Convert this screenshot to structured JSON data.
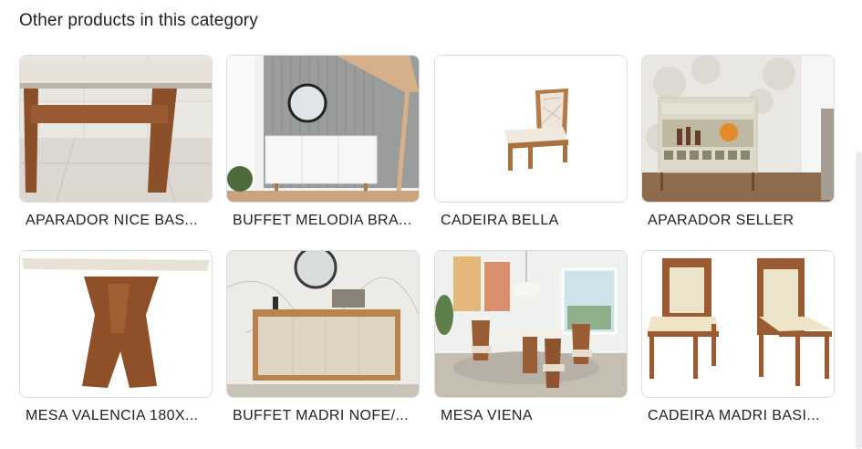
{
  "section": {
    "title": "Other products in this category"
  },
  "products": [
    {
      "name": "APARADOR NICE BAS...",
      "image": "sideboard-table-image"
    },
    {
      "name": "BUFFET MELODIA BRA...",
      "image": "buffet-room-image"
    },
    {
      "name": "CADEIRA BELLA",
      "image": "chair-image"
    },
    {
      "name": "APARADOR SELLER",
      "image": "bar-cabinet-image"
    },
    {
      "name": "MESA VALENCIA 180X...",
      "image": "dining-table-image"
    },
    {
      "name": "BUFFET MADRI NOFE/...",
      "image": "buffet-image"
    },
    {
      "name": "MESA VIENA",
      "image": "dining-room-image"
    },
    {
      "name": "CADEIRA MADRI BASI...",
      "image": "two-chairs-image"
    }
  ]
}
